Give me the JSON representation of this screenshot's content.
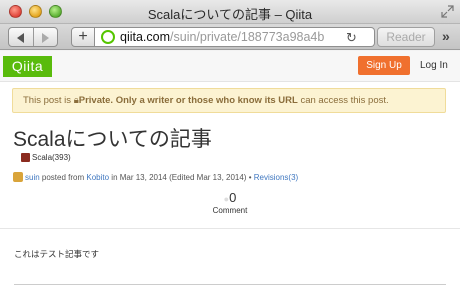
{
  "window": {
    "title": "Scalaについての記事 – Qiita"
  },
  "toolbar": {
    "plus_label": "+",
    "url_host": "qiita.com",
    "url_path": "/suin/private/188773a98a4b",
    "reader_label": "Reader"
  },
  "header": {
    "logo": "Qiita",
    "signup_label": "Sign Up",
    "login_label": "Log In"
  },
  "notice": {
    "prefix": "This post is ",
    "bold": "Private. Only a writer or those who know its URL",
    "suffix": " can access this post."
  },
  "article": {
    "title": "Scalaについての記事",
    "tag": "Scala(393)",
    "author": "suin",
    "posted_from_text": " posted from ",
    "client": "Kobito",
    "date_text": " in Mar 13, 2014 (Edited Mar 13, 2014) • ",
    "revisions": "Revisions(3)",
    "comment_count": "0",
    "comment_label": "Comment",
    "body": "これはテスト記事です"
  },
  "colors": {
    "brand": "#59bb0c",
    "signup": "#f0702e",
    "notice_bg": "#fcf3d2",
    "link": "#4078c0"
  }
}
